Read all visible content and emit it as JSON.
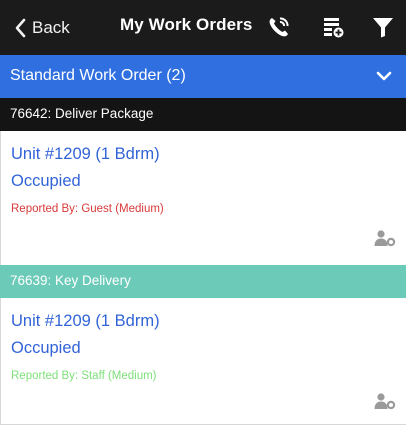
{
  "header": {
    "back_label": "Back",
    "title": "My Work Orders",
    "icons": [
      "phone-call-icon",
      "add-list-icon",
      "filter-icon"
    ]
  },
  "group": {
    "title": "Standard Work Order (2)",
    "color": "#2f6fe0",
    "icon": "chevron-down-icon"
  },
  "orders": [
    {
      "header": "76642: Deliver Package",
      "header_bg": "#141414",
      "header_color": "#ffffff",
      "unit": "Unit #1209 (1 Bdrm)",
      "status": "Occupied",
      "reported": "Reported By: Guest  (Medium)",
      "reported_color": "#d93a3a",
      "icon": "assign-user-icon"
    },
    {
      "header": "76639: Key Delivery",
      "header_bg": "#6ccbb8",
      "header_color": "#ffffff",
      "unit": "Unit #1209 (1 Bdrm)",
      "status": "Occupied",
      "reported": "Reported By: Staff  (Medium)",
      "reported_color": "#7ee07a",
      "icon": "assign-user-icon"
    }
  ]
}
